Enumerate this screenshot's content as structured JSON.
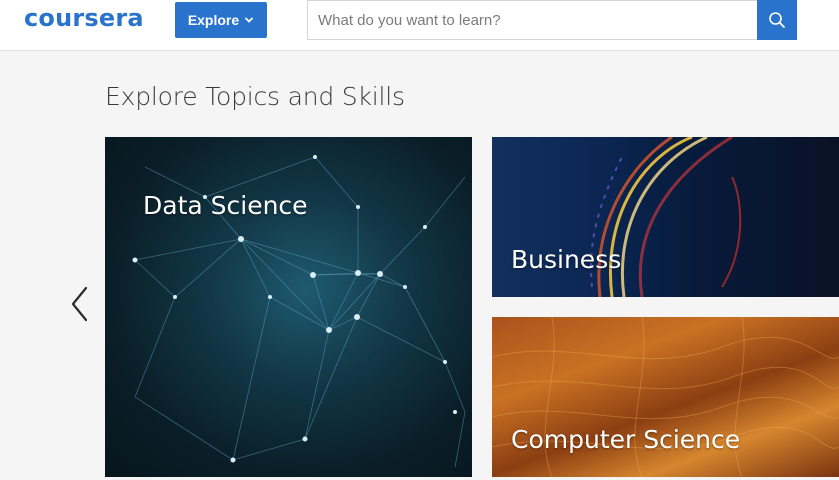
{
  "header": {
    "logo": "coursera",
    "explore_label": "Explore",
    "search_placeholder": "What do you want to learn?"
  },
  "main": {
    "title": "Explore Topics and Skills",
    "tiles": [
      {
        "label": "Data Science"
      },
      {
        "label": "Business"
      },
      {
        "label": "Computer Science"
      }
    ]
  },
  "icons": {
    "explore_chevron": "chevron-down-icon",
    "search": "search-icon",
    "previous": "chevron-left-icon"
  },
  "colors": {
    "brand": "#2a73cc",
    "background": "#f5f5f5"
  }
}
